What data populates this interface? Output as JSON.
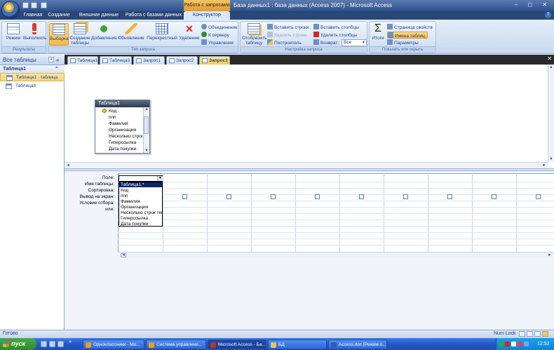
{
  "window": {
    "context_tab": "Работа с запросами",
    "title": "База данных1 : база данных (Access 2007) - Microsoft Access",
    "controls": "‒ ◻ ✕"
  },
  "ribbon_tabs": [
    "Главная",
    "Создание",
    "Внешние данные",
    "Работа с базами данных",
    "Конструктор"
  ],
  "ribbon": {
    "groups": [
      {
        "label": "Результаты",
        "buttons": [
          "Режим",
          "Выполнить"
        ]
      },
      {
        "label": "Тип запроса",
        "buttons": [
          "Выборка",
          "Создание таблицы",
          "Добавление",
          "Обновление",
          "Перекрестный",
          "Удаление"
        ],
        "small": [
          "Объединение",
          "К серверу",
          "Управление"
        ]
      },
      {
        "label": "Настройка запроса",
        "big": "Отобразить таблицу",
        "small": [
          "Вставить строки",
          "Удалить строки",
          "Построитель",
          "Вставить столбцы",
          "Удалить столбцы",
          "Возврат:"
        ],
        "return_value": "Все"
      },
      {
        "label": "Показать или скрыть",
        "big": "Итоги",
        "small": [
          "Страница свойств",
          "Имена таблиц",
          "Параметры"
        ]
      }
    ]
  },
  "nav": {
    "header": "Все таблицы",
    "group": "Таблица1",
    "items": [
      "Таблица1 : таблица",
      "Таблица3"
    ]
  },
  "doc_tabs": [
    "Таблица1",
    "Таблица3",
    "Запрос1",
    "Запрос2",
    "Запрос3"
  ],
  "table_box": {
    "title": "Таблица1",
    "fields": [
      "Код",
      "ппп",
      "Фамилия",
      "Организация",
      "Несколько строк",
      "Гиперссылка",
      "Дата покупки"
    ]
  },
  "grid": {
    "row_labels": [
      "Поле:",
      "Имя таблицы:",
      "Сортировка:",
      "Вывод на экран:",
      "Условие отбора:",
      "или:"
    ]
  },
  "dropdown": {
    "items": [
      "Таблица1.*",
      "Код",
      "ппп",
      "Фамилия",
      "Организация",
      "Несколько строк тек",
      "Гиперссылка",
      "Дата покупки"
    ]
  },
  "status": {
    "text": "Готово",
    "numlock": "Num Lock"
  },
  "taskbar": {
    "start": "пуск",
    "items": [
      "Одноклассники - Мо...",
      "Система управлени...",
      "Microsoft Access - Ба...",
      "БД",
      "Access.doc [Режим о..."
    ],
    "clock": "12:52"
  },
  "colors": {
    "accent": "#15428b",
    "ribbon_bg": "#c9d9ef",
    "selected": "#f9c84d",
    "taskbar": "#2457c6"
  }
}
